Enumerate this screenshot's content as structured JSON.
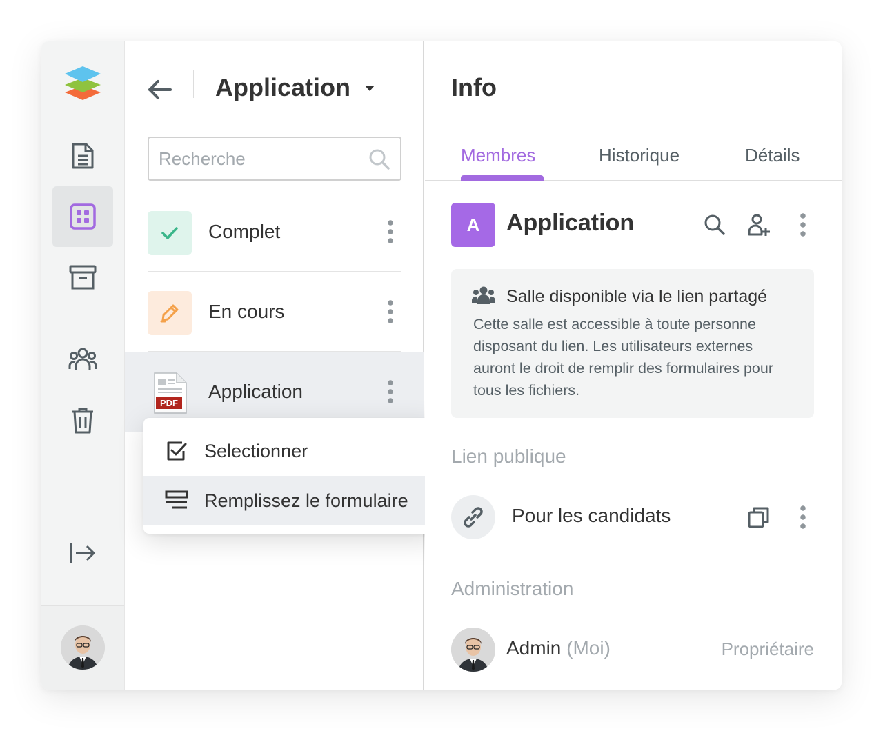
{
  "header": {
    "room_title": "Application",
    "search_placeholder": "Recherche"
  },
  "files": [
    {
      "label": "Complet",
      "icon": "check-icon",
      "icon_bg": "#dff4ec"
    },
    {
      "label": "En cours",
      "icon": "pencil-icon",
      "icon_bg": "#fdebdd"
    },
    {
      "label": "Application",
      "icon": "pdf-file-icon",
      "badge": "PDF"
    }
  ],
  "context_menu": {
    "items": [
      {
        "label": "Selectionner",
        "icon": "checkbox-icon"
      },
      {
        "label": "Remplissez le formulaire",
        "icon": "form-icon"
      }
    ]
  },
  "info": {
    "title": "Info",
    "tabs": [
      "Membres",
      "Historique",
      "Détails"
    ],
    "active_tab": "Membres",
    "room_initial": "A",
    "room_name": "Application",
    "notice_title": "Salle disponible via le lien partagé",
    "notice_text": "Cette salle est accessible à toute personne disposant du lien. Les utilisateurs externes auront le droit de remplir des formulaires pour tous les fichiers.",
    "public_link_section": "Lien publique",
    "public_link_label": "Pour les candidats",
    "admin_section": "Administration",
    "admin_name": "Admin",
    "admin_me": "(Moi)",
    "admin_role": "Propriétaire"
  },
  "colors": {
    "accent": "#a26ae0",
    "room_badge": "#a569e6",
    "check_green": "#3bb68a",
    "pencil_orange": "#f4a14a",
    "logo_blue": "#5ec3ee",
    "logo_green": "#8fc33f",
    "logo_orange": "#f36b3a"
  }
}
